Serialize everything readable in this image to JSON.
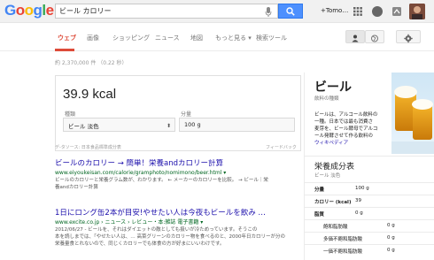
{
  "header": {
    "logo": [
      {
        "ch": "G",
        "color": "#4285f4"
      },
      {
        "ch": "o",
        "color": "#ea4335"
      },
      {
        "ch": "o",
        "color": "#fbbc05"
      },
      {
        "ch": "g",
        "color": "#4285f4"
      },
      {
        "ch": "l",
        "color": "#34a853"
      },
      {
        "ch": "e",
        "color": "#ea4335"
      }
    ],
    "query": "ビール カロリー",
    "user": "+Tomo…"
  },
  "nav": {
    "items": [
      "ウェブ",
      "画像",
      "ショッピング",
      "ニュース",
      "地図",
      "もっと見る ▾",
      "検索ツール"
    ]
  },
  "stats": "約 2,370,000 件 （0.22 秒）",
  "calorie_card": {
    "value": "39.9 kcal",
    "kind_label": "種類",
    "kind_value": "ビール 淡色",
    "amount_label": "分量",
    "amount_value": "100 g",
    "source": "デ-タソース: 日本食品標準成分表",
    "feedback": "フィードバック"
  },
  "results": [
    {
      "title": "ビールのカロリー → 簡単！栄養andカロリー計算",
      "url": "www.eiyoukeisan.com/calorie/gramphoto/nomimono/beer.html ▾",
      "snippet": [
        "ビールのカロリーと栄養グラム数が、わかります。 ← メーカーのカロリーを比較。 → ビール｜栄",
        "養andカロリー計算"
      ]
    },
    {
      "title": "1日にロング缶2本が目安!やせたい人は今夜もビールを飲み …",
      "url": "www.excite.co.jp › ニュース › レビュー・本:雑誌 電子書籍 ▾",
      "snippet": [
        "2012/06/27 - ビールを、それはダイエットの敵としても扱いが冷ためっています。そうこの",
        "本を読しまでは、「やせたい人は、… 高菜グリーンのカロリー物を食べるのと、2000年日カロリーが分の",
        "栄養量食とれないので、同じくカロリーでも体食の方が好まにいいわけです。"
      ]
    }
  ],
  "knowledge_panel": {
    "title": "ビール",
    "subtitle": "飲料の種類",
    "description": [
      "ビールは、アルコール飲料の",
      "一種。日本では最も消費さ",
      "麦芽を、ビール酵母でアルコ",
      "ール発酵させて作る飲料の",
      "一種がである。"
    ],
    "wiki": "ウィキペディア",
    "nutrition_title": "栄養成分表",
    "nutrition_sub": "ビール 淡色",
    "rows": [
      {
        "key": "分量",
        "value": "100 g",
        "bold": true,
        "indent": 0
      },
      {
        "key": "カロリー (kcal)",
        "value": "39",
        "bold": true,
        "indent": 0
      },
      {
        "key": "脂質",
        "value": "0 g",
        "bold": true,
        "indent": 0
      },
      {
        "key": "飽和脂肪酸",
        "value": "0 g",
        "bold": false,
        "indent": 1
      },
      {
        "key": "多価不飽和脂肪酸",
        "value": "0 g",
        "bold": false,
        "indent": 1
      },
      {
        "key": "一価不飽和脂肪酸",
        "value": "0 g",
        "bold": false,
        "indent": 1
      }
    ]
  }
}
